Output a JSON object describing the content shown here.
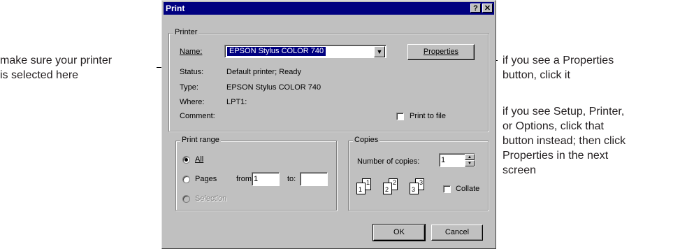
{
  "annotations": {
    "left": [
      "make sure your printer",
      "is selected here"
    ],
    "right_top": [
      "if you see a Properties",
      "button, click it"
    ],
    "right_bottom": [
      "if you see Setup, Printer,",
      "or Options, click that",
      "button instead; then click",
      "Properties in the next",
      "screen"
    ]
  },
  "dialog": {
    "title": "Print",
    "help_glyph": "?",
    "close_glyph": "✕",
    "printer_group": {
      "label": "Printer",
      "name_label": "Name:",
      "name_value": "EPSON Stylus COLOR 740",
      "properties_button": "Properties",
      "status_label": "Status:",
      "status_value": "Default printer; Ready",
      "type_label": "Type:",
      "type_value": "EPSON Stylus COLOR 740",
      "where_label": "Where:",
      "where_value": "LPT1:",
      "comment_label": "Comment:",
      "print_to_file": "Print to file"
    },
    "range_group": {
      "label": "Print range",
      "all": "All",
      "pages": "Pages",
      "from_label": "from:",
      "from_value": "1",
      "to_label": "to:",
      "to_value": "",
      "selection": "Selection"
    },
    "copies_group": {
      "label": "Copies",
      "number_label": "Number of copies:",
      "number_value": "1",
      "collate": "Collate",
      "collate_pages": [
        [
          "1",
          "1"
        ],
        [
          "2",
          "2"
        ],
        [
          "3",
          "3"
        ]
      ]
    },
    "ok_button": "OK",
    "cancel_button": "Cancel"
  }
}
